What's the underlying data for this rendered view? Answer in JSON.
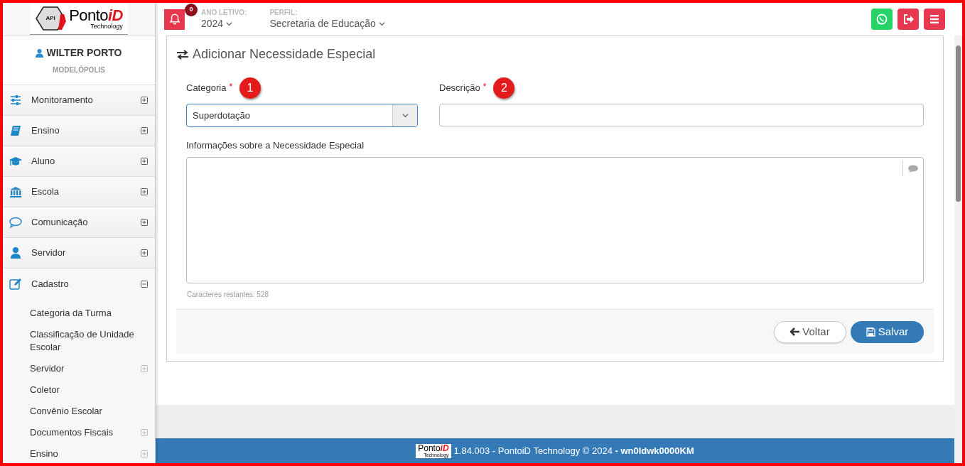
{
  "logo": {
    "badge": "API",
    "name": "Ponto",
    "name_accent": "iD",
    "tagline": "Technology"
  },
  "header": {
    "notifications": {
      "count": "0"
    },
    "year": {
      "label": "ANO LETIVO:",
      "value": "2024"
    },
    "profile": {
      "label": "PERFIL:",
      "value": "Secretaria de Educação"
    },
    "actions": [
      {
        "kind": "whatsapp"
      },
      {
        "kind": "logout"
      },
      {
        "kind": "menu"
      }
    ]
  },
  "user": {
    "name": "WILTER PORTO",
    "city": "MODELÓPOLIS"
  },
  "sidebar": {
    "items": [
      {
        "kind": "monitoring",
        "label": "Monitoramento",
        "expanded": false
      },
      {
        "kind": "teaching",
        "label": "Ensino",
        "expanded": false
      },
      {
        "kind": "student",
        "label": "Aluno",
        "expanded": false
      },
      {
        "kind": "school",
        "label": "Escola",
        "expanded": false
      },
      {
        "kind": "communication",
        "label": "Comunicação",
        "expanded": false
      },
      {
        "kind": "staff",
        "label": "Servidor",
        "expanded": false
      },
      {
        "kind": "register",
        "label": "Cadastro",
        "expanded": true,
        "children": [
          {
            "label": "Categoria da Turma",
            "has_children": false
          },
          {
            "label": "Classificação de Unidade Escolar",
            "has_children": false
          },
          {
            "label": "Servidor",
            "has_children": true
          },
          {
            "label": "Coletor",
            "has_children": false
          },
          {
            "label": "Convênio Escolar",
            "has_children": false
          },
          {
            "label": "Documentos Fiscais",
            "has_children": true
          },
          {
            "label": "Ensino",
            "has_children": true
          }
        ]
      }
    ]
  },
  "form": {
    "title": "Adicionar Necessidade Especial",
    "fields": [
      {
        "kind": "select",
        "label": "Categoria",
        "required_mark": "*",
        "marker": "1",
        "value": "Superdotação"
      },
      {
        "kind": "text",
        "label": "Descrição",
        "required_mark": "*",
        "marker": "2"
      }
    ],
    "textarea": {
      "label": "Informações sobre a Necessidade Especial",
      "counter": "Caracteres restantes: 528"
    },
    "buttons": [
      {
        "kind": "back",
        "label": "Voltar"
      },
      {
        "kind": "save",
        "label": "Salvar"
      }
    ]
  },
  "footer": {
    "logo": {
      "name": "Ponto",
      "name_accent": "iD",
      "tagline": "Technology"
    },
    "text": "1.84.003 - PontoiD Technology © 2024 **- wn0ldwk0000KM**"
  }
}
